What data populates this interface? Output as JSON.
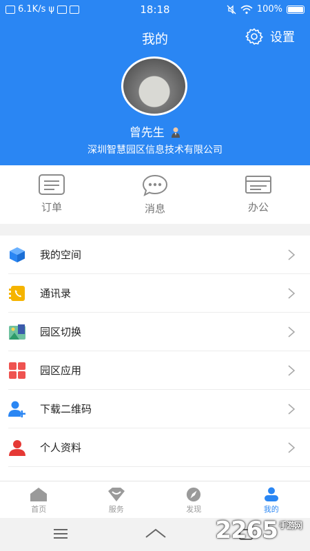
{
  "statusbar": {
    "speed": "6.1K/s",
    "time": "18:18",
    "battery": "100%"
  },
  "header": {
    "title": "我的",
    "settings_label": "设置"
  },
  "profile": {
    "name": "曾先生",
    "company": "深圳智慧园区信息技术有限公司"
  },
  "quick_actions": [
    {
      "label": "订单",
      "icon": "order-icon"
    },
    {
      "label": "消息",
      "icon": "message-icon"
    },
    {
      "label": "办公",
      "icon": "office-icon"
    }
  ],
  "menu": [
    {
      "label": "我的空间",
      "icon": "cube-icon",
      "color": "#2a86f3"
    },
    {
      "label": "通讯录",
      "icon": "contacts-icon",
      "color": "#f5b400"
    },
    {
      "label": "园区切换",
      "icon": "park-switch-icon",
      "color": "#2e9b6a"
    },
    {
      "label": "园区应用",
      "icon": "apps-grid-icon",
      "color": "#ef5350"
    },
    {
      "label": "下载二维码",
      "icon": "add-user-icon",
      "color": "#2a86f3"
    },
    {
      "label": "个人资料",
      "icon": "person-icon",
      "color": "#e53935"
    }
  ],
  "tabs": [
    {
      "label": "首页",
      "icon": "home-icon",
      "active": false
    },
    {
      "label": "服务",
      "icon": "service-icon",
      "active": false
    },
    {
      "label": "发现",
      "icon": "compass-icon",
      "active": false
    },
    {
      "label": "我的",
      "icon": "profile-icon",
      "active": true
    }
  ],
  "colors": {
    "primary": "#2a86f3",
    "background": "#f2f2f2"
  },
  "watermark": {
    "main": "2265",
    "sub": "手游网"
  }
}
